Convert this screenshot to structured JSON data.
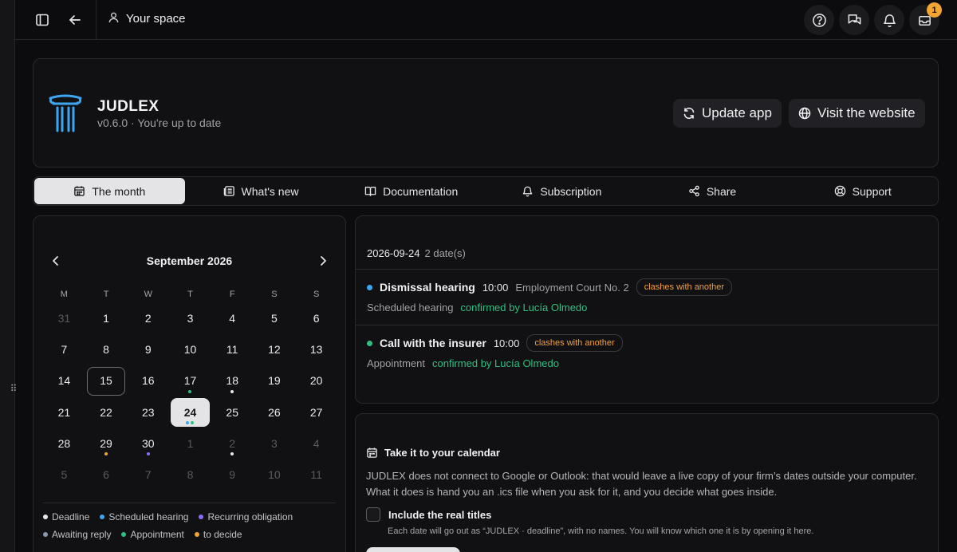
{
  "topbar": {
    "space_label": "Your space",
    "notification_count": "1",
    "icons": [
      "sidebar-toggle-icon",
      "arrow-left-icon",
      "user-icon",
      "help-icon",
      "chat-icon",
      "bell-icon",
      "inbox-icon"
    ]
  },
  "app": {
    "name": "JUDLEX",
    "version_line": "v0.6.0 · You're up to date",
    "update_label": "Update app",
    "website_label": "Visit the website",
    "logo_color": "#3ea6f0"
  },
  "tabs": [
    {
      "label": "The month",
      "icon": "calendar-icon",
      "active": true
    },
    {
      "label": "What's new",
      "icon": "news-icon"
    },
    {
      "label": "Documentation",
      "icon": "book-icon"
    },
    {
      "label": "Subscription",
      "icon": "bell-icon"
    },
    {
      "label": "Share",
      "icon": "share-icon"
    },
    {
      "label": "Support",
      "icon": "lifebuoy-icon"
    }
  ],
  "calendar": {
    "month_label": "September 2026",
    "weekdays": [
      "M",
      "T",
      "W",
      "T",
      "F",
      "S",
      "S"
    ],
    "days": [
      {
        "d": "31",
        "m": true
      },
      {
        "d": "1"
      },
      {
        "d": "2"
      },
      {
        "d": "3"
      },
      {
        "d": "4"
      },
      {
        "d": "5"
      },
      {
        "d": "6"
      },
      {
        "d": "7"
      },
      {
        "d": "8"
      },
      {
        "d": "9"
      },
      {
        "d": "10"
      },
      {
        "d": "11"
      },
      {
        "d": "12"
      },
      {
        "d": "13"
      },
      {
        "d": "14"
      },
      {
        "d": "15",
        "today": true
      },
      {
        "d": "16"
      },
      {
        "d": "17",
        "dots": [
          "#2fbf82"
        ]
      },
      {
        "d": "18",
        "dots": [
          "#e8e8ea"
        ]
      },
      {
        "d": "19"
      },
      {
        "d": "20"
      },
      {
        "d": "21"
      },
      {
        "d": "22"
      },
      {
        "d": "23"
      },
      {
        "d": "24",
        "sel": true,
        "dots": [
          "#3ea6f0",
          "#2fbf82"
        ]
      },
      {
        "d": "25"
      },
      {
        "d": "26"
      },
      {
        "d": "27"
      },
      {
        "d": "28"
      },
      {
        "d": "29",
        "dots": [
          "#f3a534"
        ]
      },
      {
        "d": "30",
        "dots": [
          "#8b6cf0"
        ]
      },
      {
        "d": "1",
        "m": true
      },
      {
        "d": "2",
        "m": true,
        "dots": [
          "#e8e8ea"
        ]
      },
      {
        "d": "3",
        "m": true
      },
      {
        "d": "4",
        "m": true
      },
      {
        "d": "5",
        "m": true
      },
      {
        "d": "6",
        "m": true
      },
      {
        "d": "7",
        "m": true
      },
      {
        "d": "8",
        "m": true
      },
      {
        "d": "9",
        "m": true
      },
      {
        "d": "10",
        "m": true
      },
      {
        "d": "11",
        "m": true
      }
    ],
    "legend": [
      {
        "label": "Deadline",
        "color": "#e8e8ea"
      },
      {
        "label": "Scheduled hearing",
        "color": "#3ea6f0"
      },
      {
        "label": "Recurring obligation",
        "color": "#8b6cf0"
      },
      {
        "label": "Awaiting reply",
        "color": "#8a9bb0"
      },
      {
        "label": "Appointment",
        "color": "#2fbf82"
      },
      {
        "label": "to decide",
        "color": "#f3a534"
      }
    ]
  },
  "day_panel": {
    "date": "2026-09-24",
    "count": "2 date(s)",
    "events": [
      {
        "title": "Dismissal hearing",
        "time": "10:00",
        "place": "Employment Court No. 2",
        "clash": "clashes with another",
        "type": "Scheduled hearing",
        "confirmed": "confirmed by Lucía Olmedo",
        "color": "#3ea6f0"
      },
      {
        "title": "Call with the insurer",
        "time": "10:00",
        "place": "",
        "clash": "clashes with another",
        "type": "Appointment",
        "confirmed": "confirmed by Lucía Olmedo",
        "color": "#2fbf82"
      }
    ]
  },
  "ics": {
    "title": "Take it to your calendar",
    "description": "JUDLEX does not connect to Google or Outlook: that would leave a live copy of your firm’s dates outside your computer. What it does is hand you an .ics file when you ask for it, and you decide what goes inside.",
    "checkbox_label": "Include the real titles",
    "checkbox_help": "Each date will go out as “JUDLEX · deadline”, with no names. You will know which one it is by opening it here."
  }
}
